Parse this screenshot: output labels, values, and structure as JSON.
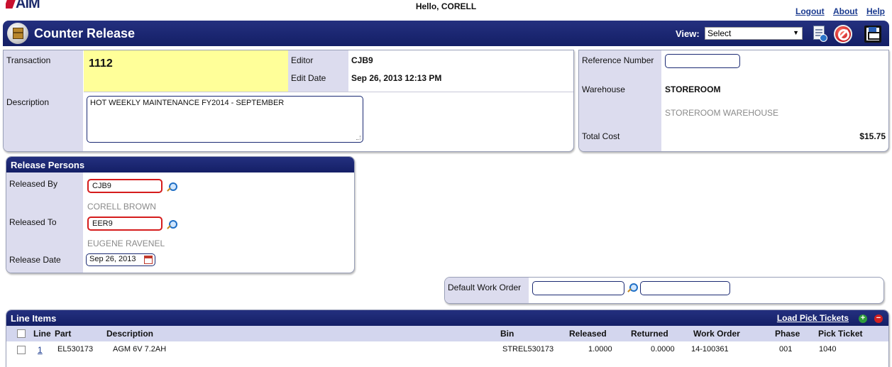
{
  "header": {
    "logo_text": "AiM",
    "greeting": "Hello, CORELL",
    "links": [
      "Logout",
      "About",
      "Help"
    ]
  },
  "titlebar": {
    "title": "Counter Release",
    "view_label": "View:",
    "view_value": "Select"
  },
  "transaction": {
    "transaction_label": "Transaction",
    "transaction_value": "1112",
    "editor_label": "Editor",
    "editor_value": "CJB9",
    "edit_date_label": "Edit Date",
    "edit_date_value": "Sep 26, 2013 12:13 PM",
    "description_label": "Description",
    "description_value": "HOT WEEKLY MAINTENANCE FY2014 - SEPTEMBER"
  },
  "reference": {
    "reference_label": "Reference Number",
    "reference_value": "",
    "warehouse_label": "Warehouse",
    "warehouse_value": "STOREROOM",
    "warehouse_desc": "STOREROOM WAREHOUSE",
    "total_cost_label": "Total Cost",
    "total_cost_value": "$15.75"
  },
  "release_persons": {
    "title": "Release Persons",
    "released_by_label": "Released By",
    "released_by_value": "CJB9",
    "released_by_name": "CORELL BROWN",
    "released_to_label": "Released To",
    "released_to_value": "EER9",
    "released_to_name": "EUGENE RAVENEL",
    "release_date_label": "Release Date",
    "release_date_value": "Sep 26, 2013"
  },
  "default_work_order": {
    "label": "Default Work Order",
    "value": "",
    "desc_value": ""
  },
  "line_items": {
    "title": "Line Items",
    "load_pick_tickets": "Load Pick Tickets",
    "columns": {
      "line": "Line",
      "part": "Part",
      "description": "Description",
      "bin": "Bin",
      "released": "Released",
      "returned": "Returned",
      "work_order": "Work Order",
      "phase": "Phase",
      "pick_ticket": "Pick Ticket"
    },
    "rows": [
      {
        "line": "1",
        "part": "EL530173",
        "description": "AGM 6V 7.2AH",
        "bin": "STREL530173",
        "released": "1.0000",
        "returned": "0.0000",
        "work_order": "14-100361",
        "phase": "001",
        "pick_ticket": "1040"
      }
    ]
  },
  "icons": [
    "counter-release-box-icon",
    "document-info-icon",
    "cancel-icon",
    "save-icon",
    "lookup-icon",
    "calendar-icon",
    "add-icon",
    "remove-icon"
  ],
  "colors": {
    "titlebar": "#1c2875",
    "label_bg": "#dcdcee",
    "highlight": "#ffff99",
    "required": "#d51c1c"
  }
}
